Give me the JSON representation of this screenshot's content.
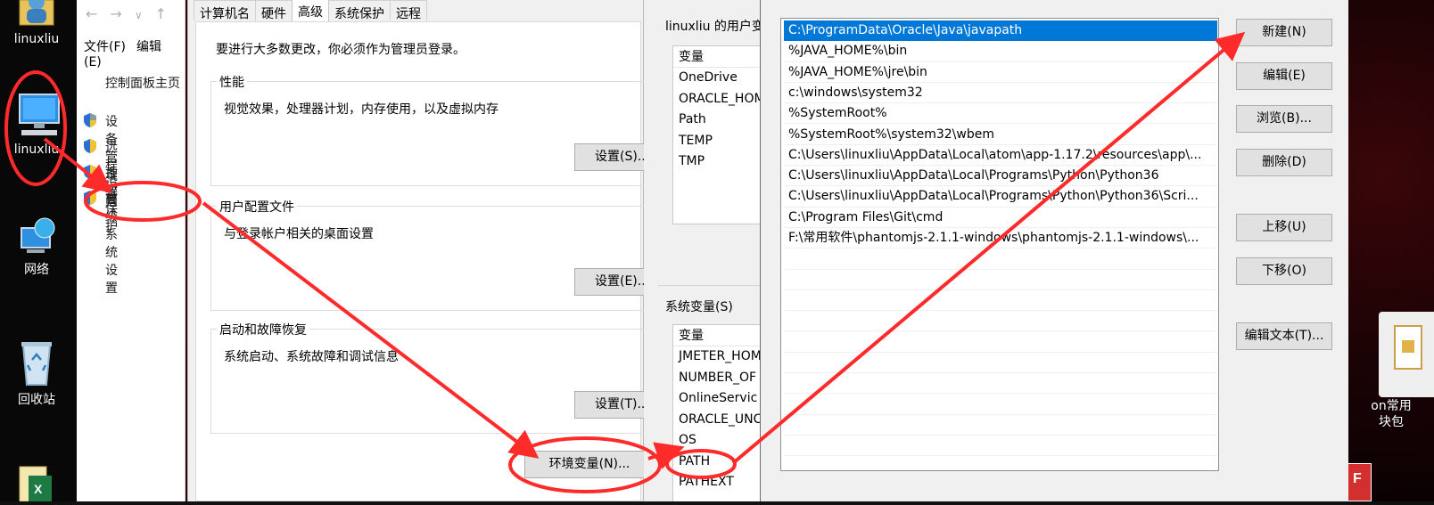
{
  "desktop": {
    "icons": [
      {
        "label": "linuxliu",
        "icon": "user-folder-icon"
      },
      {
        "label": "linuxliu",
        "icon": "computer-icon"
      },
      {
        "label": "网络",
        "icon": "network-icon"
      },
      {
        "label": "回收站",
        "icon": "recycle-bin-icon"
      }
    ],
    "right_icon_label_1": "on常用",
    "right_icon_label_2": "块包"
  },
  "control_panel": {
    "menu": [
      "文件(F)",
      "编辑(E)"
    ],
    "home_link": "控制面板主页",
    "links": [
      "设备管理器",
      "远程设置",
      "系统保护",
      "高级系统设置"
    ]
  },
  "system_properties": {
    "tabs": [
      "计算机名",
      "硬件",
      "高级",
      "系统保护",
      "远程"
    ],
    "active_tab": "高级",
    "admin_note": "要进行大多数更改，你必须作为管理员登录。",
    "groups": [
      {
        "title": "性能",
        "desc": "视觉效果，处理器计划，内存使用，以及虚拟内存",
        "button": "设置(S)..."
      },
      {
        "title": "用户配置文件",
        "desc": "与登录帐户相关的桌面设置",
        "button": "设置(E)..."
      },
      {
        "title": "启动和故障恢复",
        "desc": "系统启动、系统故障和调试信息",
        "button": "设置(T)..."
      }
    ],
    "env_button": "环境变量(N)..."
  },
  "env_vars": {
    "user_title": "linuxliu 的用户变",
    "column_header": "变量",
    "user_vars": [
      "OneDrive",
      "ORACLE_HOM",
      "Path",
      "TEMP",
      "TMP"
    ],
    "system_title": "系统变量(S)",
    "system_vars": [
      "JMETER_HOM",
      "NUMBER_OF",
      "OnlineServic",
      "ORACLE_UNC",
      "OS",
      "PATH",
      "PATHEXT"
    ]
  },
  "edit_env": {
    "paths": [
      "C:\\ProgramData\\Oracle\\Java\\javapath",
      "%JAVA_HOME%\\bin",
      "%JAVA_HOME%\\jre\\bin",
      "c:\\windows\\system32",
      "%SystemRoot%",
      "%SystemRoot%\\system32\\wbem",
      "C:\\Users\\linuxliu\\AppData\\Local\\atom\\app-1.17.2\\resources\\app\\...",
      "C:\\Users\\linuxliu\\AppData\\Local\\Programs\\Python\\Python36",
      "C:\\Users\\linuxliu\\AppData\\Local\\Programs\\Python\\Python36\\Scri...",
      "C:\\Program Files\\Git\\cmd",
      "F:\\常用软件\\phantomjs-2.1.1-windows\\phantomjs-2.1.1-windows\\..."
    ],
    "selected_index": 0,
    "buttons": {
      "new": "新建(N)",
      "edit": "编辑(E)",
      "browse": "浏览(B)...",
      "delete": "删除(D)",
      "move_up": "上移(U)",
      "move_down": "下移(O)",
      "edit_text": "编辑文本(T)..."
    }
  },
  "colors": {
    "selection": "#0078d7",
    "annotation_red": "#ff2a2a",
    "dialog_bg": "#f0f0f0"
  }
}
